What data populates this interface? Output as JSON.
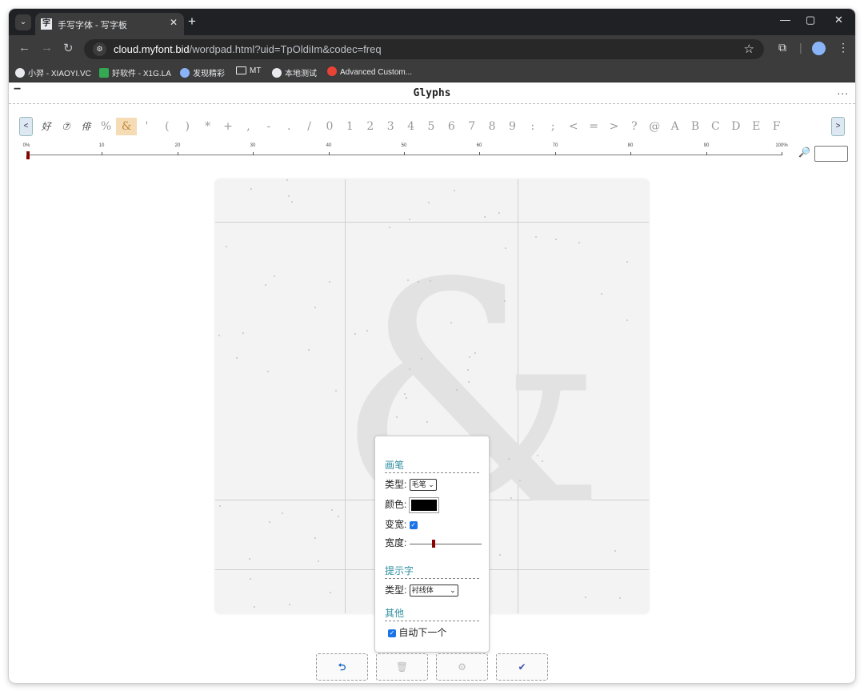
{
  "browser": {
    "tab_title": "手写字体 - 写字板",
    "tab_favicon": "字",
    "url_host": "cloud.myfont.bid",
    "url_path": "/wordpad.html?uid=TpOldiIm&codec=freq",
    "bookmarks": [
      {
        "label": "小羿 - XIAOYI.VC",
        "icon": "avatar-icon",
        "color": "#e8eaed"
      },
      {
        "label": "好软件 - X1G.LA",
        "icon": "app-icon",
        "color": "#34a853"
      },
      {
        "label": "发现精彩",
        "icon": "wordpress-icon",
        "color": "#8ab4f8"
      },
      {
        "label": "MT",
        "icon": "folder-icon",
        "color": "#e8eaed"
      },
      {
        "label": "本地测试",
        "icon": "globe-icon",
        "color": "#e8eaed"
      },
      {
        "label": "Advanced Custom...",
        "icon": "acf-icon",
        "color": "#ea4335"
      }
    ]
  },
  "app": {
    "title": "Glyphs",
    "collapse": "−",
    "more": "...",
    "prev": "<",
    "next": ">",
    "glyphs": [
      {
        "char": "好 ",
        "hand": true
      },
      {
        "char": "⑦",
        "hand": true
      },
      {
        "char": "俳",
        "hand": true
      },
      {
        "char": "%",
        "hand": false
      },
      {
        "char": "&",
        "hand": false,
        "selected": true
      },
      {
        "char": "'",
        "hand": false
      },
      {
        "char": "(",
        "hand": false
      },
      {
        "char": ")",
        "hand": false
      },
      {
        "char": "*",
        "hand": false
      },
      {
        "char": "+",
        "hand": false
      },
      {
        "char": ",",
        "hand": false
      },
      {
        "char": "-",
        "hand": false
      },
      {
        "char": ".",
        "hand": false
      },
      {
        "char": "/",
        "hand": false
      },
      {
        "char": "0",
        "hand": false
      },
      {
        "char": "1",
        "hand": false
      },
      {
        "char": "2",
        "hand": false
      },
      {
        "char": "3",
        "hand": false
      },
      {
        "char": "4",
        "hand": false
      },
      {
        "char": "5",
        "hand": false
      },
      {
        "char": "6",
        "hand": false
      },
      {
        "char": "7",
        "hand": false
      },
      {
        "char": "8",
        "hand": false
      },
      {
        "char": "9",
        "hand": false
      },
      {
        "char": ":",
        "hand": false
      },
      {
        "char": ";",
        "hand": false
      },
      {
        "char": "<",
        "hand": false
      },
      {
        "char": "=",
        "hand": false
      },
      {
        "char": ">",
        "hand": false
      },
      {
        "char": "?",
        "hand": false
      },
      {
        "char": "@",
        "hand": false
      },
      {
        "char": "A",
        "hand": false
      },
      {
        "char": "B",
        "hand": false
      },
      {
        "char": "C",
        "hand": false
      },
      {
        "char": "D",
        "hand": false
      },
      {
        "char": "E",
        "hand": false
      },
      {
        "char": "F",
        "hand": false
      }
    ],
    "ruler_labels": [
      "0%",
      "10",
      "20",
      "30",
      "40",
      "50",
      "60",
      "70",
      "80",
      "90",
      "100%"
    ],
    "progress": 0,
    "zoom_value": "",
    "hint_char": "&"
  },
  "settings": {
    "brush_heading": "画笔",
    "brush_type_label": "类型:",
    "brush_type_value": "毛笔",
    "color_label": "颜色:",
    "color_value": "#000000",
    "variable_width_label": "变宽:",
    "variable_width_checked": true,
    "width_label": "宽度:",
    "width_level": 0.33,
    "hint_heading": "提示字",
    "hint_type_label": "类型:",
    "hint_type_value": "衬线体",
    "other_heading": "其他",
    "auto_next_label": "自动下一个",
    "auto_next_checked": true
  },
  "actions": [
    {
      "name": "undo-button",
      "icon": "undo-icon",
      "glyph": "⮌",
      "color": "#1565c0"
    },
    {
      "name": "delete-button",
      "icon": "trash-icon",
      "glyph": "🗑",
      "color": "#bbbbbb"
    },
    {
      "name": "settings-button",
      "icon": "gear-icon",
      "glyph": "⚙",
      "color": "#bbbbbb"
    },
    {
      "name": "confirm-button",
      "icon": "check-icon",
      "glyph": "✔",
      "color": "#3f51b5"
    }
  ]
}
